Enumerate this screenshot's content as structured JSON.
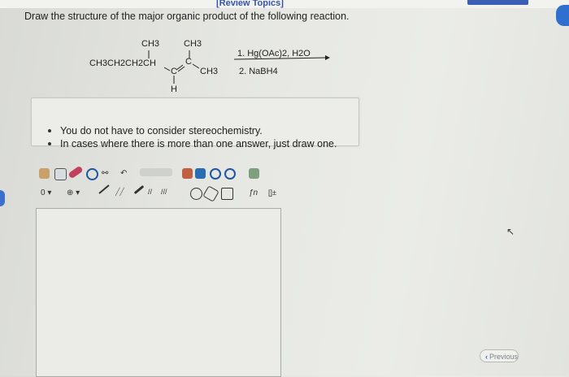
{
  "header": {
    "review_topics": "[Review Topics]"
  },
  "question": {
    "text": "Draw the structure of the major organic product of the following reaction."
  },
  "reaction": {
    "methyl_left": "CH3",
    "methyl_right": "CH3",
    "chain": "CH3CH2CH2CH",
    "carbon_left": "C",
    "carbon_right": "C",
    "methyl_end": "CH3",
    "hydrogen": "H",
    "reagent_1": "1. Hg(OAc)2, H2O",
    "reagent_2": "2. NaBH4"
  },
  "instructions": [
    "You do not have to consider stereochemistry.",
    "In cases where there is more than one answer, just draw one."
  ],
  "toolbar": {
    "charge_label": "0",
    "plus_label": "⊕",
    "help_label": "?",
    "fn_label": "ƒn",
    "bracket_label": "[]±"
  },
  "navigation": {
    "previous_label": "Previous"
  }
}
